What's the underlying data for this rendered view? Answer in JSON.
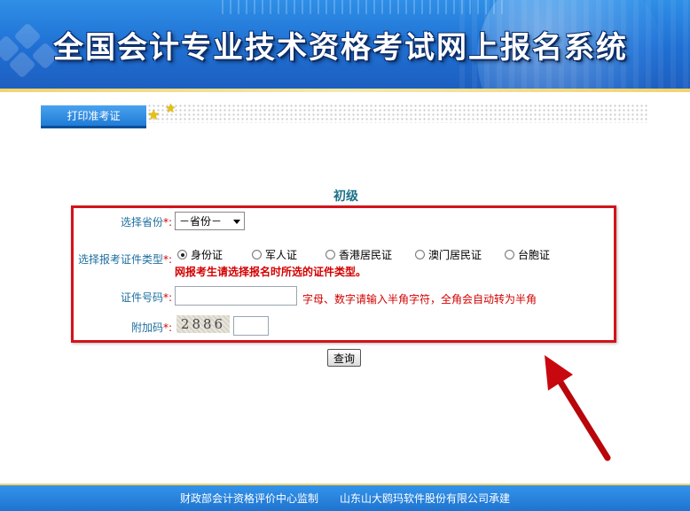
{
  "header": {
    "title": "全国会计专业技术资格考试网上报名系统"
  },
  "tabs": {
    "print_label": "打印准考证"
  },
  "section": {
    "title": "初级"
  },
  "form": {
    "province_label": "选择省份",
    "province_value": "－省份－",
    "idtype_label": "选择报考证件类型",
    "id_types": [
      "身份证",
      "军人证",
      "香港居民证",
      "澳门居民证",
      "台胞证"
    ],
    "id_type_selected": "身份证",
    "idtype_hint": "网报考生请选择报名时所选的证件类型。",
    "idnum_label": "证件号码",
    "idnum_hint": "字母、数字请输入半角字符，全角会自动转为半角",
    "captcha_label": "附加码",
    "captcha_value": "2886",
    "required_mark": "*:",
    "query_button": "查询"
  },
  "footer": {
    "supervisor": "财政部会计资格评价中心监制",
    "developer": "山东山大鸥玛软件股份有限公司承建"
  },
  "colors": {
    "brand_blue": "#1f74cf",
    "highlight_red": "#d3141a",
    "label_blue": "#1d6fa0"
  }
}
